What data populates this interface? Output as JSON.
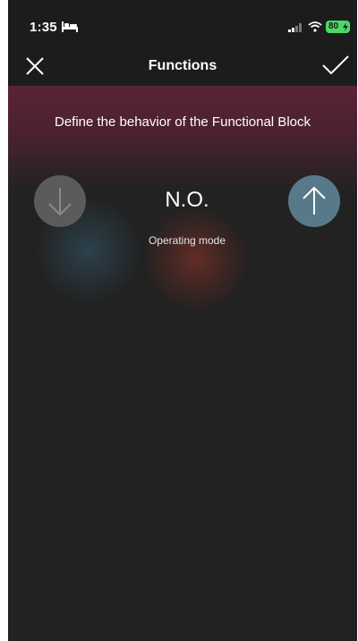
{
  "status_bar": {
    "time": "1:35",
    "battery": "80",
    "battery_color": "#4cd964"
  },
  "nav": {
    "title": "Functions",
    "close_icon": "close-icon",
    "confirm_icon": "checkmark-icon"
  },
  "main": {
    "description": "Define the behavior of the Functional Block",
    "mode_value": "N.O.",
    "mode_label": "Operating mode",
    "down_icon": "arrow-down-icon",
    "up_icon": "arrow-up-icon",
    "accent_header": "#5a2336",
    "up_button_color": "#587989",
    "down_button_color": "#5b5b5b"
  }
}
